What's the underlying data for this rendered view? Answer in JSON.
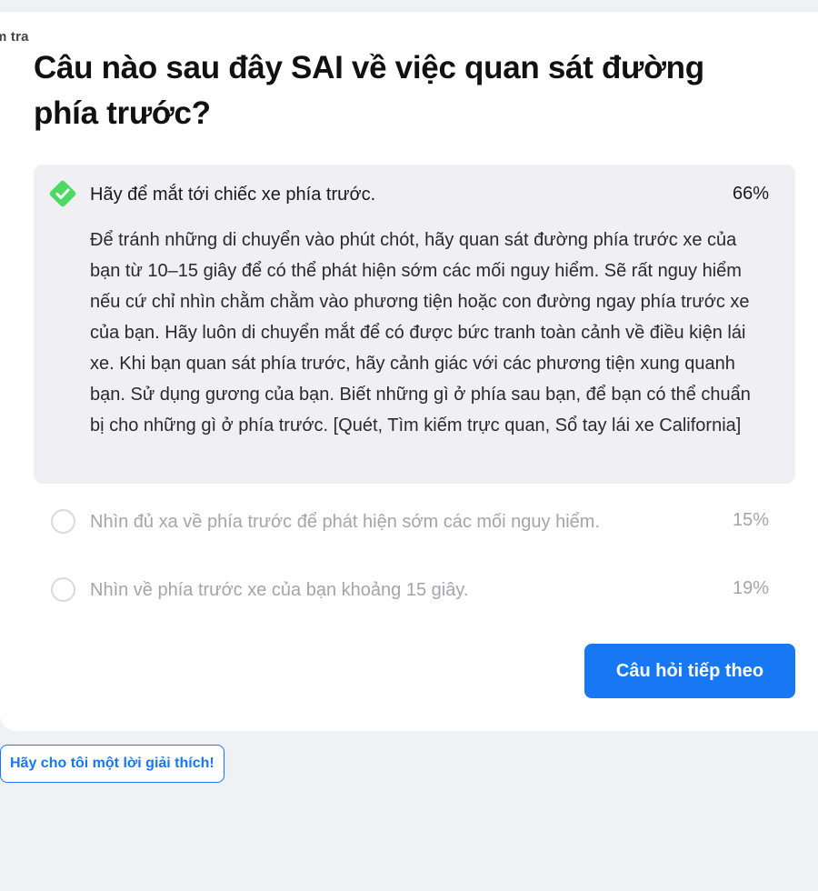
{
  "header": {
    "clipped_label": "m tra"
  },
  "question": {
    "text": "Câu nào sau đây SAI về việc quan sát đường phía trước?"
  },
  "answers": [
    {
      "text": "Hãy để mắt tới chiếc xe phía trước.",
      "percent": "66%",
      "selected": true,
      "icon": "check-diamond-icon",
      "explanation": "Để tránh những di chuyển vào phút chót, hãy quan sát đường phía trước xe của bạn từ 10–15 giây để có thể phát hiện sớm các mối nguy hiểm. Sẽ rất nguy hiểm nếu cứ chỉ nhìn chằm chằm vào phương tiện hoặc con đường ngay phía trước xe của bạn. Hãy luôn di chuyển mắt để có được bức tranh toàn cảnh về điều kiện lái xe. Khi bạn quan sát phía trước, hãy cảnh giác với các phương tiện xung quanh bạn. Sử dụng gương của bạn. Biết những gì ở phía sau bạn, để bạn có thể chuẩn bị cho những gì ở phía trước. [Quét, Tìm kiếm trực quan, Sổ tay lái xe California]"
    },
    {
      "text": "Nhìn đủ xa về phía trước để phát hiện sớm các mối nguy hiểm.",
      "percent": "15%",
      "selected": false
    },
    {
      "text": "Nhìn về phía trước xe của bạn khoảng 15 giây.",
      "percent": "19%",
      "selected": false
    }
  ],
  "actions": {
    "next_label": "Câu hỏi tiếp theo",
    "explain_label": "Hãy cho tôi một lời giải thích!"
  },
  "colors": {
    "accent": "#1877f2",
    "correct": "#4cd964",
    "selected_bg": "#f0f0f4",
    "dim_text": "#a4a4ab",
    "page_bg": "#f0f1f5"
  }
}
